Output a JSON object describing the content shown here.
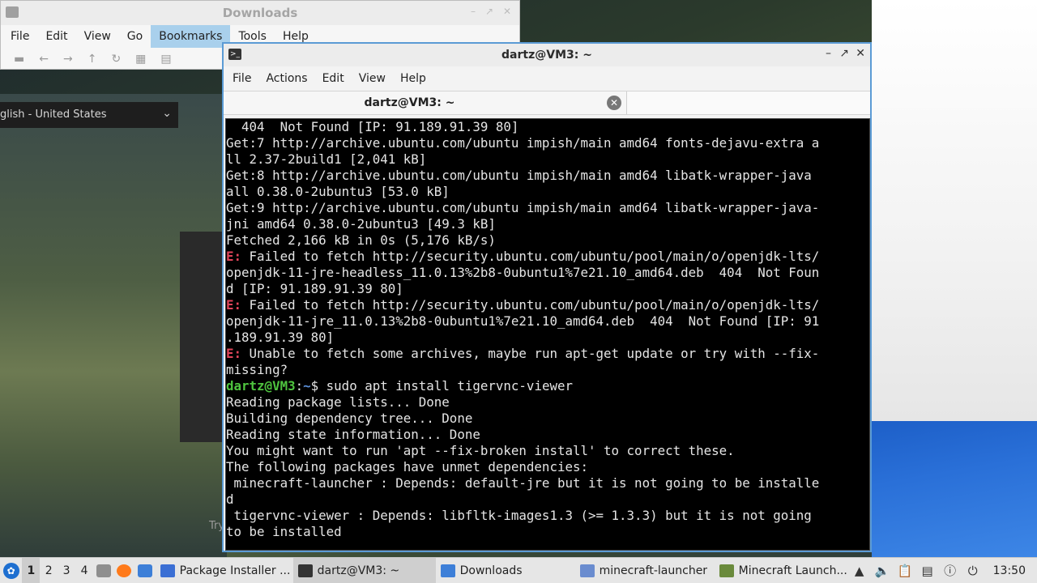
{
  "background": {
    "language_select": "glish - United States",
    "try_text": "Try"
  },
  "downloads_window": {
    "title": "Downloads",
    "menu": [
      "File",
      "Edit",
      "View",
      "Go",
      "Bookmarks",
      "Tools",
      "Help"
    ],
    "active_menu": "Bookmarks"
  },
  "terminal": {
    "title": "dartz@VM3: ~",
    "menu": [
      "File",
      "Actions",
      "Edit",
      "View",
      "Help"
    ],
    "tab_label": "dartz@VM3: ~",
    "lines": [
      {
        "type": "plain",
        "text": "  404  Not Found [IP: 91.189.91.39 80]"
      },
      {
        "type": "plain",
        "text": "Get:7 http://archive.ubuntu.com/ubuntu impish/main amd64 fonts-dejavu-extra a"
      },
      {
        "type": "plain",
        "text": "ll 2.37-2build1 [2,041 kB]"
      },
      {
        "type": "plain",
        "text": "Get:8 http://archive.ubuntu.com/ubuntu impish/main amd64 libatk-wrapper-java"
      },
      {
        "type": "plain",
        "text": "all 0.38.0-2ubuntu3 [53.0 kB]"
      },
      {
        "type": "plain",
        "text": "Get:9 http://archive.ubuntu.com/ubuntu impish/main amd64 libatk-wrapper-java-"
      },
      {
        "type": "plain",
        "text": "jni amd64 0.38.0-2ubuntu3 [49.3 kB]"
      },
      {
        "type": "plain",
        "text": "Fetched 2,166 kB in 0s (5,176 kB/s)"
      },
      {
        "type": "error",
        "prefix": "E:",
        "text": " Failed to fetch http://security.ubuntu.com/ubuntu/pool/main/o/openjdk-lts/"
      },
      {
        "type": "plain",
        "text": "openjdk-11-jre-headless_11.0.13%2b8-0ubuntu1%7e21.10_amd64.deb  404  Not Foun"
      },
      {
        "type": "plain",
        "text": "d [IP: 91.189.91.39 80]"
      },
      {
        "type": "error",
        "prefix": "E:",
        "text": " Failed to fetch http://security.ubuntu.com/ubuntu/pool/main/o/openjdk-lts/"
      },
      {
        "type": "plain",
        "text": "openjdk-11-jre_11.0.13%2b8-0ubuntu1%7e21.10_amd64.deb  404  Not Found [IP: 91"
      },
      {
        "type": "plain",
        "text": ".189.91.39 80]"
      },
      {
        "type": "error",
        "prefix": "E:",
        "text": " Unable to fetch some archives, maybe run apt-get update or try with --fix-"
      },
      {
        "type": "plain",
        "text": "missing?"
      },
      {
        "type": "prompt",
        "user": "dartz@VM3",
        "sep": ":",
        "path": "~",
        "text": "$ sudo apt install tigervnc-viewer"
      },
      {
        "type": "plain",
        "text": "Reading package lists... Done"
      },
      {
        "type": "plain",
        "text": "Building dependency tree... Done"
      },
      {
        "type": "plain",
        "text": "Reading state information... Done"
      },
      {
        "type": "plain",
        "text": "You might want to run 'apt --fix-broken install' to correct these."
      },
      {
        "type": "plain",
        "text": "The following packages have unmet dependencies:"
      },
      {
        "type": "plain",
        "text": " minecraft-launcher : Depends: default-jre but it is not going to be installe"
      },
      {
        "type": "plain",
        "text": "d"
      },
      {
        "type": "plain",
        "text": " tigervnc-viewer : Depends: libfltk-images1.3 (>= 1.3.3) but it is not going"
      },
      {
        "type": "plain",
        "text": "to be installed"
      }
    ]
  },
  "taskbar": {
    "workspaces": [
      "1",
      "2",
      "3",
      "4"
    ],
    "active_workspace": "1",
    "tasks": [
      {
        "label": "Package Installer ...",
        "icon": "package-installer-icon",
        "color": "#3b6fd4"
      },
      {
        "label": "dartz@VM3: ~",
        "icon": "terminal-icon",
        "color": "#333333"
      },
      {
        "label": "Downloads",
        "icon": "folder-icon",
        "color": "#3d7fd8"
      },
      {
        "label": "minecraft-launcher",
        "icon": "window-icon",
        "color": "#6a8ccf"
      },
      {
        "label": "Minecraft Launch...",
        "icon": "minecraft-icon",
        "color": "#6a8a3c"
      }
    ],
    "active_task": 1,
    "clock": "13:50"
  }
}
